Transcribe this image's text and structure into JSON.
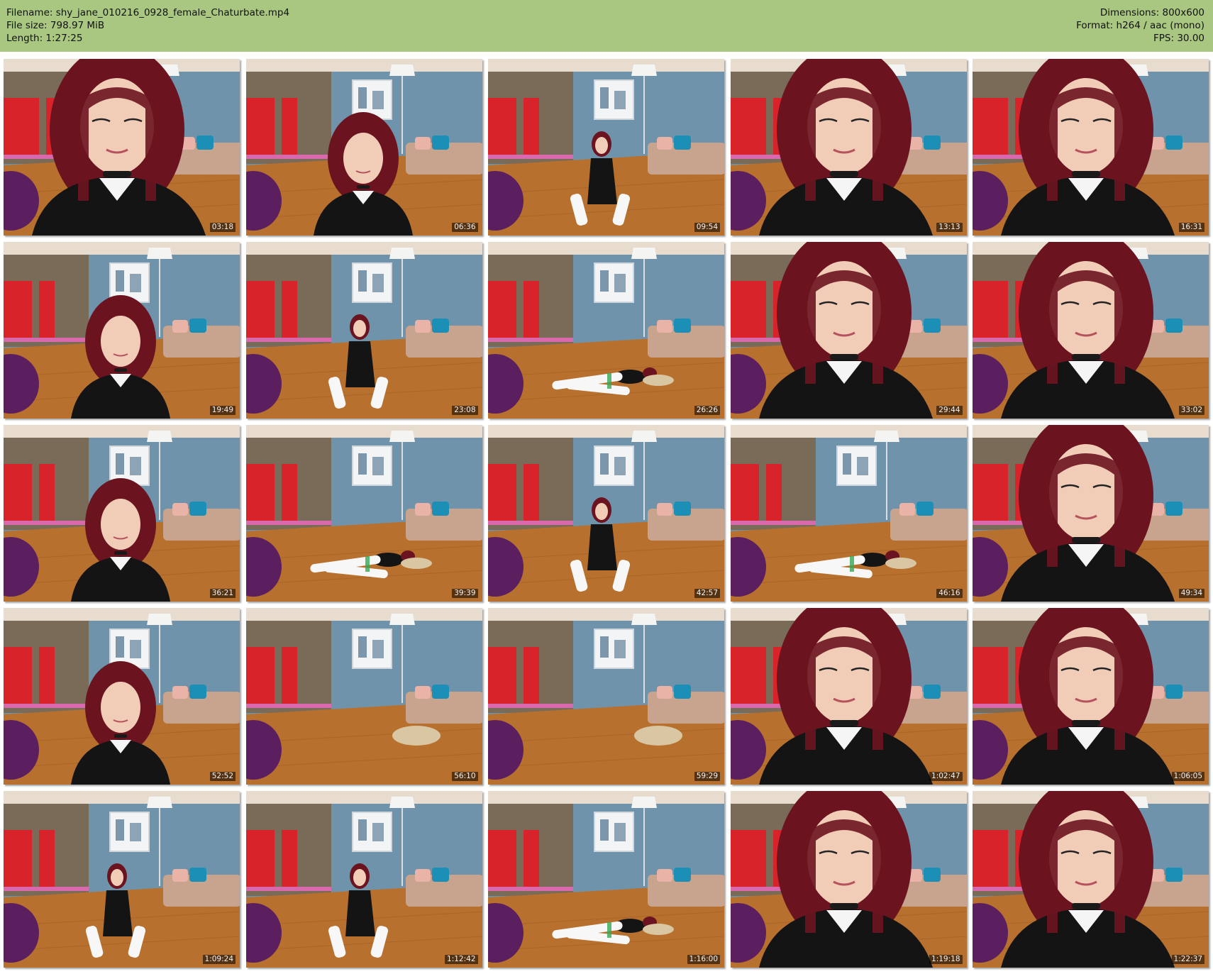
{
  "file_info": {
    "filename_line": "Filename: shy_jane_010216_0928_female_Chaturbate.mp4",
    "filesize_line": "File size: 798.97 MiB",
    "length_line": "Length: 1:27:25",
    "dimensions_line": "Dimensions: 800x600",
    "format_line": "Format: h264 / aac (mono)",
    "fps_line": "FPS: 30.00"
  },
  "colors": {
    "header_bg": "#a9c780",
    "wall": "#6f93ab",
    "floor": "#b8702e",
    "hair": "#6b1420",
    "dress": "#141414",
    "chair": "#5b1f5f",
    "curtain": "#d8232a",
    "sofa": "#c8a48e"
  },
  "thumbnails": [
    {
      "time": "03:18",
      "scene": "close"
    },
    {
      "time": "06:36",
      "scene": "mid"
    },
    {
      "time": "09:54",
      "scene": "far"
    },
    {
      "time": "13:13",
      "scene": "close"
    },
    {
      "time": "16:31",
      "scene": "close"
    },
    {
      "time": "19:49",
      "scene": "mid"
    },
    {
      "time": "23:08",
      "scene": "far"
    },
    {
      "time": "26:26",
      "scene": "floor"
    },
    {
      "time": "29:44",
      "scene": "close"
    },
    {
      "time": "33:02",
      "scene": "close"
    },
    {
      "time": "36:21",
      "scene": "mid"
    },
    {
      "time": "39:39",
      "scene": "floor"
    },
    {
      "time": "42:57",
      "scene": "far"
    },
    {
      "time": "46:16",
      "scene": "floor"
    },
    {
      "time": "49:34",
      "scene": "close"
    },
    {
      "time": "52:52",
      "scene": "mid"
    },
    {
      "time": "56:10",
      "scene": "empty"
    },
    {
      "time": "59:29",
      "scene": "empty"
    },
    {
      "time": "1:02:47",
      "scene": "close"
    },
    {
      "time": "1:06:05",
      "scene": "close"
    },
    {
      "time": "1:09:24",
      "scene": "far"
    },
    {
      "time": "1:12:42",
      "scene": "far"
    },
    {
      "time": "1:16:00",
      "scene": "floor"
    },
    {
      "time": "1:19:18",
      "scene": "close"
    },
    {
      "time": "1:22:37",
      "scene": "close"
    }
  ]
}
